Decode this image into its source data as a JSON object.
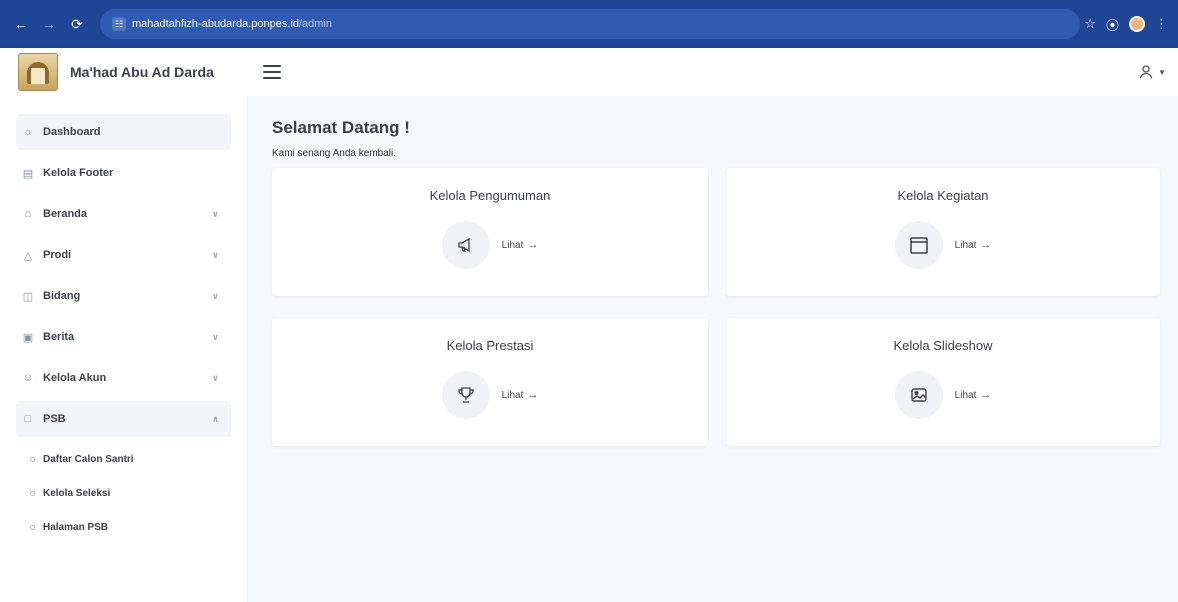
{
  "browser": {
    "url_host": "mahadtahfizh-abudarda.ponpes.id",
    "url_path": "/admin"
  },
  "brand": {
    "name": "Ma'had Abu Ad Darda"
  },
  "sidebar": {
    "items": [
      {
        "label": "Dashboard",
        "icon": "dashboard-icon",
        "active": true,
        "expandable": false
      },
      {
        "label": "Kelola Footer",
        "icon": "layout-icon",
        "expandable": false
      },
      {
        "label": "Beranda",
        "icon": "home-icon",
        "expandable": true
      },
      {
        "label": "Prodi",
        "icon": "cap-icon",
        "expandable": true
      },
      {
        "label": "Bidang",
        "icon": "grid-icon",
        "expandable": true
      },
      {
        "label": "Berita",
        "icon": "news-icon",
        "expandable": true
      },
      {
        "label": "Kelola Akun",
        "icon": "users-icon",
        "expandable": true
      },
      {
        "label": "PSB",
        "icon": "folder-icon",
        "expandable": true,
        "expanded": true
      }
    ],
    "psb_sub_items": [
      "Daftar Calon Santri",
      "Kelola Seleksi",
      "Halaman PSB"
    ]
  },
  "main": {
    "title": "Selamat Datang !",
    "subtitle": "Kami senang Anda kembali.",
    "cards": [
      {
        "title": "Kelola Pengumuman",
        "link": "Lihat",
        "icon": "megaphone-icon"
      },
      {
        "title": "Kelola Kegiatan",
        "link": "Lihat",
        "icon": "calendar-icon"
      },
      {
        "title": "Kelola Prestasi",
        "link": "Lihat",
        "icon": "trophy-icon"
      },
      {
        "title": "Kelola Slideshow",
        "link": "Lihat",
        "icon": "image-icon"
      }
    ]
  },
  "colors": {
    "browser_bar": "#1f4596",
    "main_bg": "#f7f8fb",
    "text": "#3c4048"
  }
}
